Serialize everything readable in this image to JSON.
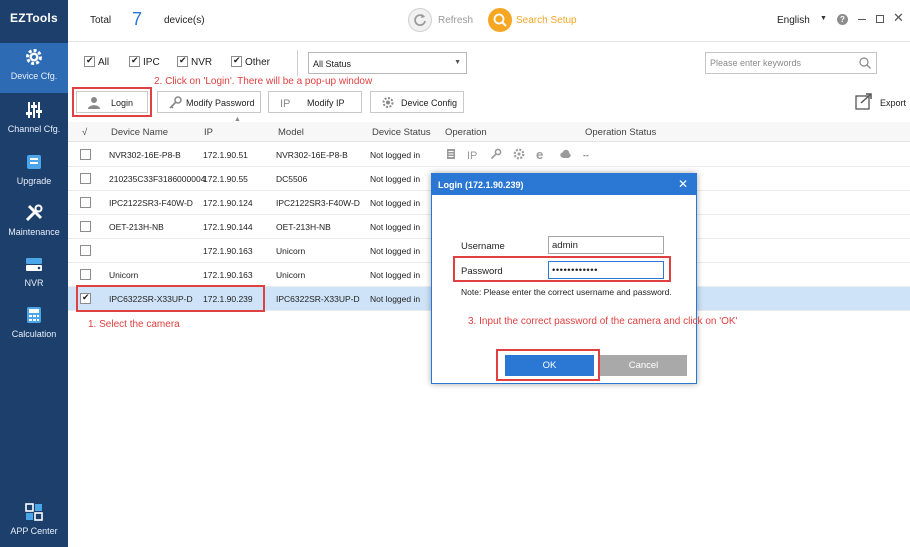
{
  "app": {
    "logo": "EZTools"
  },
  "sidebar": {
    "items": [
      {
        "label": "Device Cfg.",
        "icon": "gear-icon"
      },
      {
        "label": "Channel Cfg.",
        "icon": "sliders-icon"
      },
      {
        "label": "Upgrade",
        "icon": "upgrade-icon"
      },
      {
        "label": "Maintenance",
        "icon": "tools-icon"
      },
      {
        "label": "NVR",
        "icon": "nvr-icon"
      },
      {
        "label": "Calculation",
        "icon": "calculator-icon"
      },
      {
        "label": "APP Center",
        "icon": "app-grid-icon"
      }
    ],
    "active": "Device Cfg."
  },
  "topbar": {
    "total_label": "Total",
    "total_count": "7",
    "total_unit": "device(s)",
    "refresh_label": "Refresh",
    "search_setup_label": "Search Setup",
    "language": "English"
  },
  "filters": {
    "checkboxes": [
      {
        "label": "All",
        "checked": true
      },
      {
        "label": "IPC",
        "checked": true
      },
      {
        "label": "NVR",
        "checked": true
      },
      {
        "label": "Other",
        "checked": true
      }
    ],
    "status_value": "All Status",
    "search_placeholder": "Please enter keywords"
  },
  "toolbar": {
    "login": "Login",
    "modify_password": "Modify Password",
    "modify_ip": "Modify IP",
    "device_config": "Device Config",
    "export": "Export"
  },
  "table": {
    "check_header": "√",
    "headers": [
      "Device Name",
      "IP",
      "Model",
      "Device Status",
      "Operation",
      "Operation Status"
    ],
    "rows": [
      {
        "name": "NVR302-16E-P8-B",
        "ip": "172.1.90.51",
        "model": "NVR302-16E-P8-B",
        "status": "Not logged in",
        "op_status": "--",
        "selected": false
      },
      {
        "name": "210235C33F3186000004",
        "ip": "172.1.90.55",
        "model": "DC5506",
        "status": "Not logged in",
        "op_status": "",
        "selected": false
      },
      {
        "name": "IPC2122SR3-F40W-D",
        "ip": "172.1.90.124",
        "model": "IPC2122SR3-F40W-D",
        "status": "Not logged in",
        "op_status": "",
        "selected": false
      },
      {
        "name": "OET-213H-NB",
        "ip": "172.1.90.144",
        "model": "OET-213H-NB",
        "status": "Not logged in",
        "op_status": "",
        "selected": false
      },
      {
        "name": "",
        "ip": "172.1.90.163",
        "model": "Unicorn",
        "status": "Not logged in",
        "op_status": "",
        "selected": false
      },
      {
        "name": "Unicorn",
        "ip": "172.1.90.163",
        "model": "Unicorn",
        "status": "Not logged in",
        "op_status": "",
        "selected": false
      },
      {
        "name": "IPC6322SR-X33UP-D",
        "ip": "172.1.90.239",
        "model": "IPC6322SR-X33UP-D",
        "status": "Not logged in",
        "op_status": "",
        "selected": true
      }
    ]
  },
  "annotations": {
    "step1": "1. Select the camera",
    "step2": "2. Click on 'Login'. There will be a pop-up window",
    "step3": "3. Input the correct password of the camera  and click on 'OK'"
  },
  "dialog": {
    "title": "Login (172.1.90.239)",
    "username_label": "Username",
    "username_value": "admin",
    "password_label": "Password",
    "password_value": "••••••••••••",
    "note": "Note: Please enter the correct username and password.",
    "ok": "OK",
    "cancel": "Cancel"
  },
  "colors": {
    "sidebar": "#1d3f6b",
    "sidebar_active": "#2d6bb5",
    "accent": "#2a78d4",
    "annotation": "#e04040",
    "search_setup": "#f5a623",
    "selected_row": "#cfe3f8"
  }
}
